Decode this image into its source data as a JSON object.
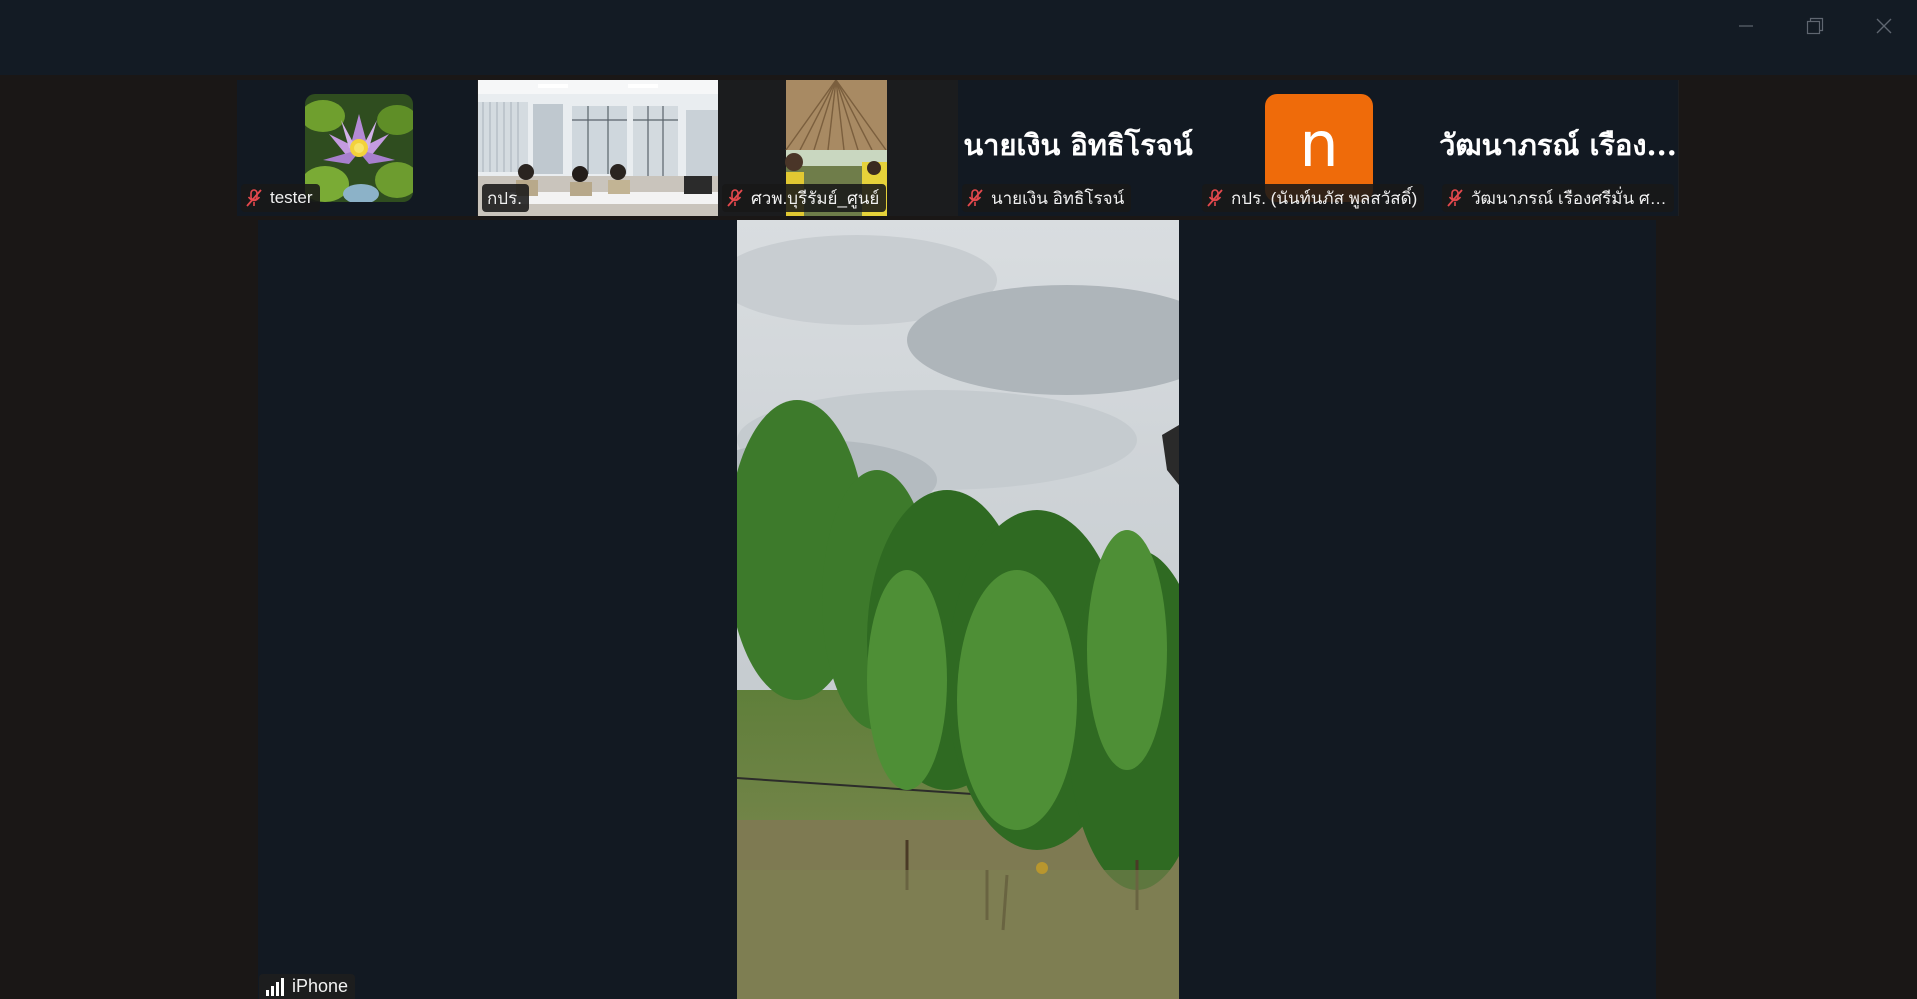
{
  "window": {
    "controls": {
      "minimize_icon": "minimize-icon",
      "restore_icon": "restore-icon",
      "close_icon": "close-icon"
    }
  },
  "participants": [
    {
      "name": "tester",
      "muted": true,
      "view": "avatar-image",
      "avatar_icon": "water-lily-image"
    },
    {
      "name": "กปร.",
      "muted": false,
      "view": "video"
    },
    {
      "name": "ศวพ.บุรีรัมย์_ศูนย์",
      "muted": true,
      "view": "video"
    },
    {
      "name": "นายเงิน  อิทธิโรจน์",
      "display_name": "นายเงิน  อิทธิโรจน์",
      "muted": true,
      "view": "name"
    },
    {
      "name": "กปร. (นันท์นภัส พูลสวัสดิ์)",
      "muted": true,
      "view": "avatar-letter",
      "avatar_letter": "n",
      "avatar_color": "#ef6b0a"
    },
    {
      "name": "วัฒนาภรณ์  เรืองศรีมั่น ศว...",
      "display_name": "วัฒนาภรณ์  เรือง...",
      "muted": true,
      "view": "name"
    }
  ],
  "speaker": {
    "device_label": "iPhone",
    "signal_icon": "signal-bars-icon"
  },
  "colors": {
    "titlebar": "#131b24",
    "background": "#1a1716",
    "tile": "#121922",
    "muted_mic": "#e5484d",
    "avatar_orange": "#ef6b0a"
  }
}
